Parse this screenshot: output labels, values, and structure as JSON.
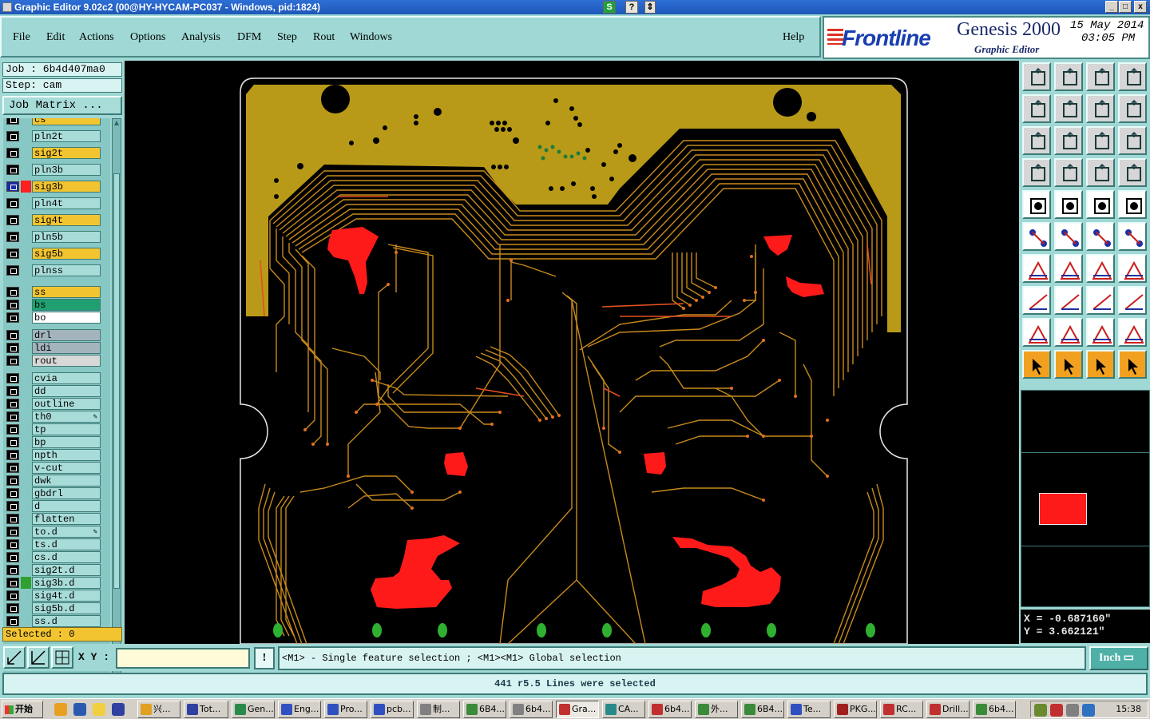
{
  "window": {
    "title": "Graphic Editor 9.02c2 (00@HY-HYCAM-PC037 - Windows, pid:1824)"
  },
  "menu": [
    "File",
    "Edit",
    "Actions",
    "Options",
    "Analysis",
    "DFM",
    "Step",
    "Rout",
    "Windows"
  ],
  "help_label": "Help",
  "brand": {
    "logo": "Frontline",
    "product": "Genesis 2000",
    "subtitle": "Graphic Editor",
    "date": "15 May 2014",
    "time": "03:05 PM"
  },
  "job": {
    "job_line": "Job : 6b4d407ma0",
    "step_line": "Step: cam",
    "matrix_button": "Job Matrix ..."
  },
  "layers": [
    {
      "name": "cs",
      "color": "#f2c530"
    },
    {
      "name": "pln2t",
      "color": "#a8dcd8"
    },
    {
      "name": "sig2t",
      "color": "#f2c530"
    },
    {
      "name": "pln3b",
      "color": "#a8dcd8"
    },
    {
      "name": "sig3b",
      "color": "#f2c530",
      "swatch": "#ff2020",
      "active": true
    },
    {
      "name": "pln4t",
      "color": "#a8dcd8"
    },
    {
      "name": "sig4t",
      "color": "#f2c530"
    },
    {
      "name": "pln5b",
      "color": "#a8dcd8"
    },
    {
      "name": "sig5b",
      "color": "#f2c530"
    },
    {
      "name": "plnss",
      "color": "#a8dcd8"
    },
    {
      "name": "ss",
      "color": "#f2c530"
    },
    {
      "name": "bs",
      "color": "#20a070"
    },
    {
      "name": "bo",
      "color": "#ffffff"
    },
    {
      "name": "drl",
      "color": "#a4b4bc"
    },
    {
      "name": "ldi",
      "color": "#a4b4bc"
    },
    {
      "name": "rout",
      "color": "#d8d8d8"
    },
    {
      "name": "cvia",
      "color": "#a8dcd8"
    },
    {
      "name": "dd",
      "color": "#a8dcd8"
    },
    {
      "name": "outline",
      "color": "#a8dcd8"
    },
    {
      "name": "th0",
      "color": "#a8dcd8",
      "mark": "✎"
    },
    {
      "name": "tp",
      "color": "#a8dcd8"
    },
    {
      "name": "bp",
      "color": "#a8dcd8"
    },
    {
      "name": "npth",
      "color": "#a8dcd8"
    },
    {
      "name": "v-cut",
      "color": "#a8dcd8"
    },
    {
      "name": "dwk",
      "color": "#a8dcd8"
    },
    {
      "name": "gbdrl",
      "color": "#a8dcd8"
    },
    {
      "name": "d",
      "color": "#a8dcd8"
    },
    {
      "name": "flatten",
      "color": "#a8dcd8"
    },
    {
      "name": "to.d",
      "color": "#a8dcd8",
      "mark": "✎"
    },
    {
      "name": "ts.d",
      "color": "#a8dcd8"
    },
    {
      "name": "cs.d",
      "color": "#a8dcd8"
    },
    {
      "name": "sig2t.d",
      "color": "#a8dcd8"
    },
    {
      "name": "sig3b.d",
      "color": "#a8dcd8",
      "swatch": "#30a030"
    },
    {
      "name": "sig4t.d",
      "color": "#a8dcd8"
    },
    {
      "name": "sig5b.d",
      "color": "#a8dcd8"
    },
    {
      "name": "ss.d",
      "color": "#a8dcd8"
    }
  ],
  "selected_label": "Selected : 0",
  "coords": {
    "x": "X = -0.687160\"",
    "y": "Y = 3.662121\""
  },
  "bottom": {
    "xy_label": "X Y :",
    "xy_value": "",
    "hint": "<M1> - Single feature selection ; <M1><M1> Global selection",
    "units": "Inch",
    "status": "441 r5.5 Lines were selected"
  },
  "taskbar": {
    "start": "开始",
    "tasks": [
      "兴...",
      "Tot...",
      "Gen...",
      "Eng...",
      "Pro...",
      "pcb...",
      "制...",
      "6B4...",
      "6b4...",
      "Gra...",
      "CA...",
      "6b4...",
      "外...",
      "6B4...",
      "Te...",
      "PKG...",
      "RC...",
      "Drill...",
      "6b4..."
    ],
    "active_task": "Gra...",
    "clock": "15:38"
  },
  "colors": {
    "panel": "#9fd8d4",
    "copper_fill": "#b89a18",
    "trace": "#d08a20",
    "highlight": "#ff1a1a",
    "pad_green": "#30b030"
  }
}
